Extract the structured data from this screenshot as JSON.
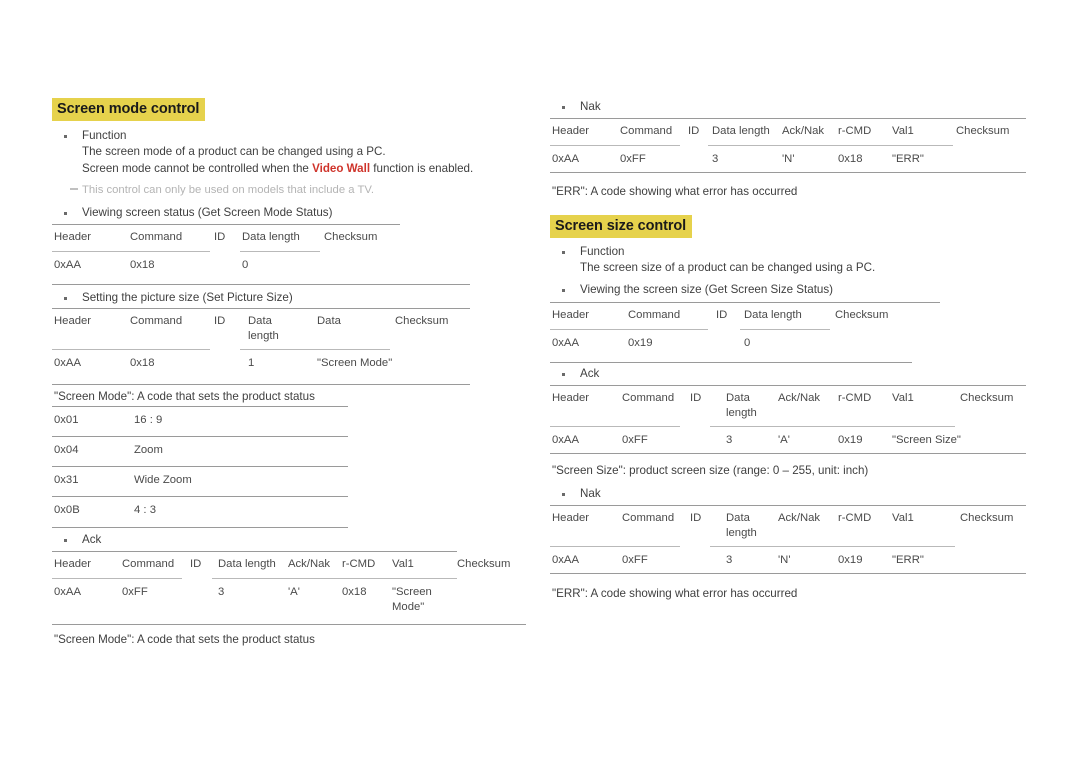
{
  "document": {
    "type": "product-manual-page",
    "language": "en",
    "background_color": "#ffffff",
    "highlight_color": "#e6d24c",
    "accent_red": "#cf342b",
    "rule_color": "#9a9a9a"
  },
  "left_column": {
    "heading": "Screen mode control",
    "function_label": "Function",
    "function_desc_1": "The screen mode of a product can be changed using a PC.",
    "function_desc_2_prefix": "Screen mode cannot be controlled when the ",
    "function_desc_2_accent": "Video Wall",
    "function_desc_2_suffix": " function is enabled.",
    "note": "This control can only be used on models that include a TV.",
    "get_status_label": "Viewing screen status (Get Screen Mode Status)",
    "get_status_table": {
      "headers": [
        "Header",
        "Command",
        "ID",
        "Data length",
        "Checksum"
      ],
      "row": [
        "0xAA",
        "0x18",
        "",
        "0",
        ""
      ]
    },
    "set_size_label": "Setting the picture size (Set Picture Size)",
    "set_size_table": {
      "headers": [
        "Header",
        "Command",
        "ID",
        "Data\nlength",
        "Data",
        "Checksum"
      ],
      "row": [
        "0xAA",
        "0x18",
        "",
        "1",
        "\"Screen Mode\"",
        ""
      ]
    },
    "screen_mode_caption": "\"Screen Mode\": A code that sets the product status",
    "screen_mode_codes": {
      "rows": [
        {
          "code": "0x01",
          "meaning": "16 : 9"
        },
        {
          "code": "0x04",
          "meaning": "Zoom"
        },
        {
          "code": "0x31",
          "meaning": "Wide Zoom"
        },
        {
          "code": "0x0B",
          "meaning": "4 : 3"
        }
      ]
    },
    "ack_label": "Ack",
    "ack_table": {
      "headers": [
        "Header",
        "Command",
        "ID",
        "Data length",
        "Ack/Nak",
        "r-CMD",
        "Val1",
        "Checksum"
      ],
      "row": [
        "0xAA",
        "0xFF",
        "",
        "3",
        "'A'",
        "0x18",
        "\"Screen\nMode\"",
        ""
      ]
    },
    "ack_caption": "\"Screen Mode\": A code that sets the product status"
  },
  "right_column": {
    "nak_label": "Nak",
    "nak_table": {
      "headers": [
        "Header",
        "Command",
        "ID",
        "Data length",
        "Ack/Nak",
        "r-CMD",
        "Val1",
        "Checksum"
      ],
      "row": [
        "0xAA",
        "0xFF",
        "",
        "3",
        "'N'",
        "0x18",
        "\"ERR\"",
        ""
      ]
    },
    "nak_caption": "\"ERR\": A code showing what error has occurred",
    "heading": "Screen size control",
    "function_label": "Function",
    "function_desc_1": "The screen size of a product can be changed using a PC.",
    "get_status_label": "Viewing the screen size (Get Screen Size Status)",
    "get_status_table": {
      "headers": [
        "Header",
        "Command",
        "ID",
        "Data length",
        "Checksum"
      ],
      "row": [
        "0xAA",
        "0x19",
        "",
        "0",
        ""
      ]
    },
    "ack_label": "Ack",
    "ack_table": {
      "headers": [
        "Header",
        "Command",
        "ID",
        "Data\nlength",
        "Ack/Nak",
        "r-CMD",
        "Val1",
        "Checksum"
      ],
      "row": [
        "0xAA",
        "0xFF",
        "",
        "3",
        "'A'",
        "0x19",
        "\"Screen Size\"",
        ""
      ]
    },
    "ack_caption": "\"Screen Size\": product screen size (range: 0 – 255, unit: inch)",
    "nak2_label": "Nak",
    "nak2_table": {
      "headers": [
        "Header",
        "Command",
        "ID",
        "Data\nlength",
        "Ack/Nak",
        "r-CMD",
        "Val1",
        "Checksum"
      ],
      "row": [
        "0xAA",
        "0xFF",
        "",
        "3",
        "'N'",
        "0x19",
        "\"ERR\"",
        ""
      ]
    },
    "nak2_caption": "\"ERR\": A code showing what error has occurred"
  }
}
